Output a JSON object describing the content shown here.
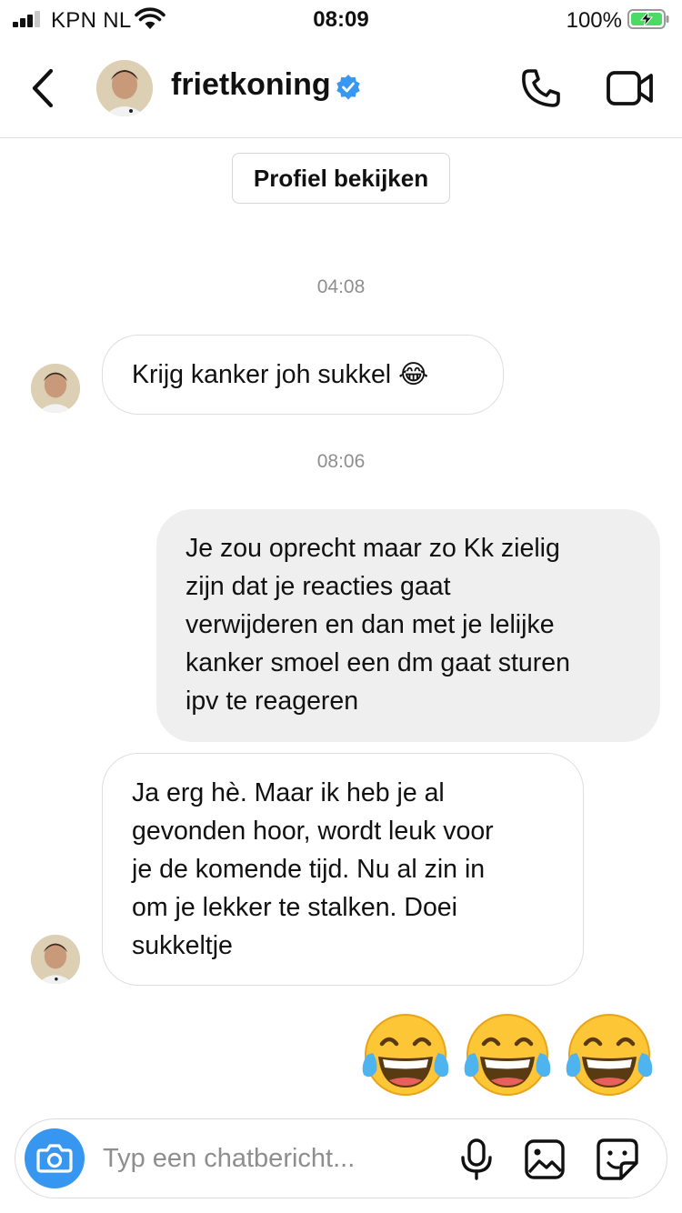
{
  "status_bar": {
    "carrier": "KPN NL",
    "time": "08:09",
    "battery": "100%"
  },
  "header": {
    "username": "frietkoning",
    "verified": true,
    "icons": [
      "back-chevron-icon",
      "avatar",
      "verified-badge-icon",
      "phone-icon",
      "video-camera-icon"
    ]
  },
  "profile_button": "Profiel bekijken",
  "conversation": [
    {
      "type": "timestamp",
      "text": "04:08"
    },
    {
      "type": "incoming",
      "text": "Krijg kanker joh sukkel 😂"
    },
    {
      "type": "timestamp",
      "text": "08:06"
    },
    {
      "type": "outgoing",
      "lines": [
        "Je zou oprecht maar zo Kk zielig",
        "zijn dat je reacties gaat",
        "verwijderen en dan met je lelijke",
        "kanker smoel een dm gaat sturen",
        "ipv te reageren"
      ]
    },
    {
      "type": "incoming",
      "lines": [
        "Ja erg hè. Maar ik heb je al",
        "gevonden hoor, wordt leuk voor",
        "je de komende tijd. Nu al zin in",
        "om je lekker te stalken. Doei",
        "sukkeltje"
      ]
    },
    {
      "type": "emoji",
      "text": "😂😂😂"
    }
  ],
  "composer": {
    "placeholder": "Typ een chatbericht...",
    "icons": [
      "camera-icon",
      "microphone-icon",
      "gallery-icon",
      "sticker-icon"
    ]
  },
  "colors": {
    "accent_blue": "#3797f0",
    "verified_blue": "#3897f0",
    "outgoing_bubble": "#efefef",
    "timestamp_grey": "#8e8e8e"
  }
}
